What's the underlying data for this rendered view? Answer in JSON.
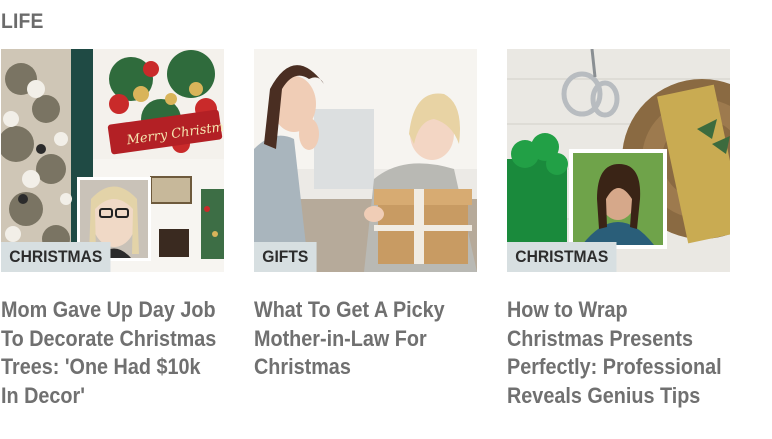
{
  "section": {
    "title": "LIFE"
  },
  "cards": [
    {
      "tag": "CHRISTMAS",
      "headline": "Mom Gave Up Day Job To Decorate Christmas Trees: 'One Had $10k In Decor'",
      "image_text": "Merry Christmas"
    },
    {
      "tag": "GIFTS",
      "headline": "What To Get A Picky Mother-in-Law For Christmas"
    },
    {
      "tag": "CHRISTMAS",
      "headline": "How to Wrap Christmas Presents Perfectly: Professional Reveals Genius Tips"
    }
  ],
  "colors": {
    "tag_bg": "#d7dfe1",
    "headline": "#707070",
    "section_title": "#6b6b6b"
  }
}
